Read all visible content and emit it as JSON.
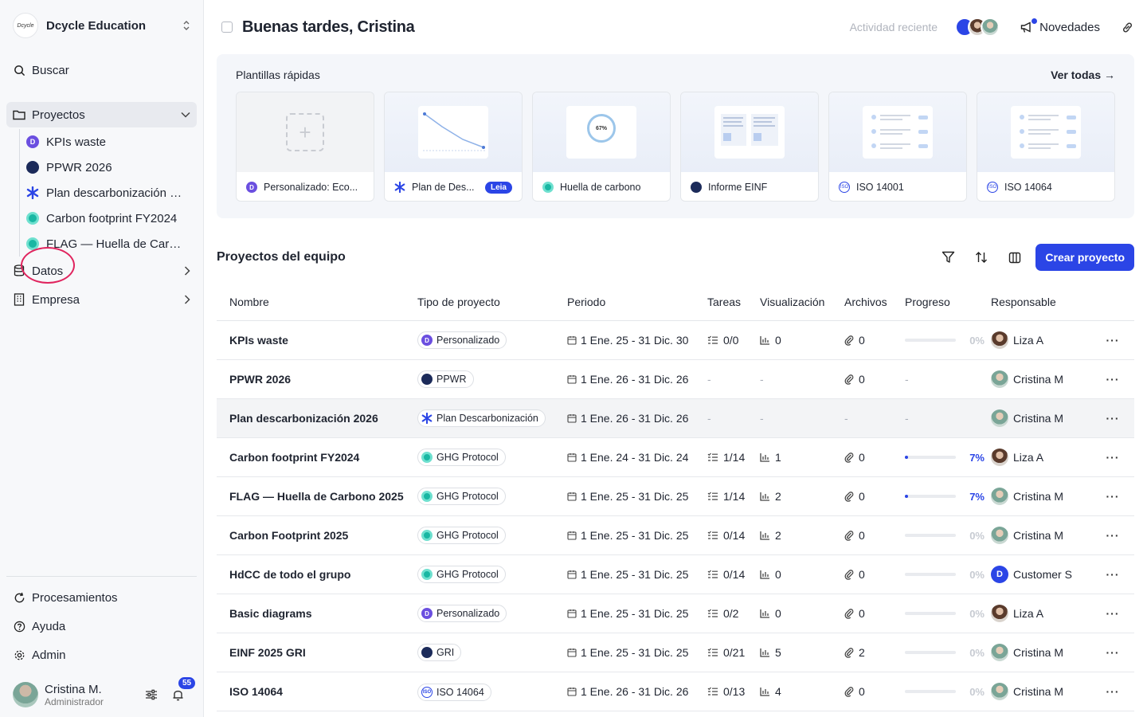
{
  "org": {
    "logo_text": "Dcycle",
    "name": "Dcycle Education"
  },
  "nav": {
    "search": "Buscar",
    "projects": "Proyectos",
    "project_items": [
      {
        "label": "KPIs waste",
        "icon": "purple-dcycle-icon"
      },
      {
        "label": "PPWR 2026",
        "icon": "navy-globe-icon"
      },
      {
        "label": "Plan descarbonización 2026",
        "icon": "blue-asterisk-icon"
      },
      {
        "label": "Carbon footprint FY2024",
        "icon": "teal-ring-icon"
      },
      {
        "label": "FLAG — Huella de Carbono 2025",
        "icon": "teal-ring-icon"
      }
    ],
    "data": "Datos",
    "company": "Empresa",
    "processing": "Procesamientos",
    "help": "Ayuda",
    "admin": "Admin"
  },
  "user": {
    "name": "Cristina M.",
    "role": "Administrador",
    "notifications": "55"
  },
  "header": {
    "greeting": "Buenas tardes, Cristina",
    "recent_activity": "Actividad reciente",
    "news": "Novedades"
  },
  "templates": {
    "title": "Plantillas rápidas",
    "see_all": "Ver todas",
    "items": [
      {
        "label": "Personalizado: Eco...",
        "preview": "plus"
      },
      {
        "label": "Plan de Des...",
        "badge": "Leia",
        "preview": "line-chart"
      },
      {
        "label": "Huella de carbono",
        "preview": "gauge",
        "gauge_text": "67%"
      },
      {
        "label": "Informe EINF",
        "preview": "document"
      },
      {
        "label": "ISO 14001",
        "preview": "list"
      },
      {
        "label": "ISO 14064",
        "preview": "list"
      }
    ]
  },
  "projects_table": {
    "title": "Proyectos del equipo",
    "create_button": "Crear proyecto",
    "columns": [
      "Nombre",
      "Tipo de proyecto",
      "Periodo",
      "Tareas",
      "Visualización",
      "Archivos",
      "Progreso",
      "Responsable"
    ],
    "rows": [
      {
        "name": "KPIs waste",
        "type": "Personalizado",
        "type_icon": "purple",
        "period": "1 Ene. 25 - 31 Dic. 30",
        "tasks": "0/0",
        "visualizations": "0",
        "files": "0",
        "progress": "0%",
        "progress_value": 0,
        "owner": "Liza A",
        "owner_avatar": "liza"
      },
      {
        "name": "PPWR 2026",
        "type": "PPWR",
        "type_icon": "navy",
        "period": "1 Ene. 26 - 31 Dic. 26",
        "tasks": "-",
        "visualizations": "-",
        "files": "0",
        "progress": "-",
        "progress_value": null,
        "owner": "Cristina M",
        "owner_avatar": "cristina"
      },
      {
        "name": "Plan descarbonización 2026",
        "type": "Plan Descarbonización",
        "type_icon": "asterisk",
        "period": "1 Ene. 26 - 31 Dic. 26",
        "tasks": "-",
        "visualizations": "-",
        "files": "-",
        "progress": "-",
        "progress_value": null,
        "owner": "Cristina M",
        "owner_avatar": "cristina",
        "highlighted": true
      },
      {
        "name": "Carbon footprint FY2024",
        "type": "GHG Protocol",
        "type_icon": "teal",
        "period": "1 Ene. 24 - 31 Dic. 24",
        "tasks": "1/14",
        "visualizations": "1",
        "files": "0",
        "progress": "7%",
        "progress_value": 7,
        "owner": "Liza A",
        "owner_avatar": "liza"
      },
      {
        "name": "FLAG — Huella de Carbono 2025",
        "type": "GHG Protocol",
        "type_icon": "teal",
        "period": "1 Ene. 25 - 31 Dic. 25",
        "tasks": "1/14",
        "visualizations": "2",
        "files": "0",
        "progress": "7%",
        "progress_value": 7,
        "owner": "Cristina M",
        "owner_avatar": "cristina"
      },
      {
        "name": "Carbon Footprint 2025",
        "type": "GHG Protocol",
        "type_icon": "teal",
        "period": "1 Ene. 25 - 31 Dic. 25",
        "tasks": "0/14",
        "visualizations": "2",
        "files": "0",
        "progress": "0%",
        "progress_value": 0,
        "owner": "Cristina M",
        "owner_avatar": "cristina"
      },
      {
        "name": "HdCC de todo el grupo",
        "type": "GHG Protocol",
        "type_icon": "teal",
        "period": "1 Ene. 25 - 31 Dic. 25",
        "tasks": "0/14",
        "visualizations": "0",
        "files": "0",
        "progress": "0%",
        "progress_value": 0,
        "owner": "Customer S",
        "owner_avatar": "customer"
      },
      {
        "name": "Basic diagrams",
        "type": "Personalizado",
        "type_icon": "purple",
        "period": "1 Ene. 25 - 31 Dic. 25",
        "tasks": "0/2",
        "visualizations": "0",
        "files": "0",
        "progress": "0%",
        "progress_value": 0,
        "owner": "Liza A",
        "owner_avatar": "liza"
      },
      {
        "name": "EINF 2025 GRI",
        "type": "GRI",
        "type_icon": "navy",
        "period": "1 Ene. 25 - 31 Dic. 25",
        "tasks": "0/21",
        "visualizations": "5",
        "files": "2",
        "progress": "0%",
        "progress_value": 0,
        "owner": "Cristina M",
        "owner_avatar": "cristina"
      },
      {
        "name": "ISO 14064",
        "type": "ISO 14064",
        "type_icon": "iso",
        "period": "1 Ene. 26 - 31 Dic. 26",
        "tasks": "0/13",
        "visualizations": "4",
        "files": "0",
        "progress": "0%",
        "progress_value": 0,
        "owner": "Cristina M",
        "owner_avatar": "cristina"
      }
    ]
  },
  "colors": {
    "accent": "#2b45e6",
    "highlight_ring": "#e0245e",
    "sidebar_bg": "#f7f8fa"
  }
}
